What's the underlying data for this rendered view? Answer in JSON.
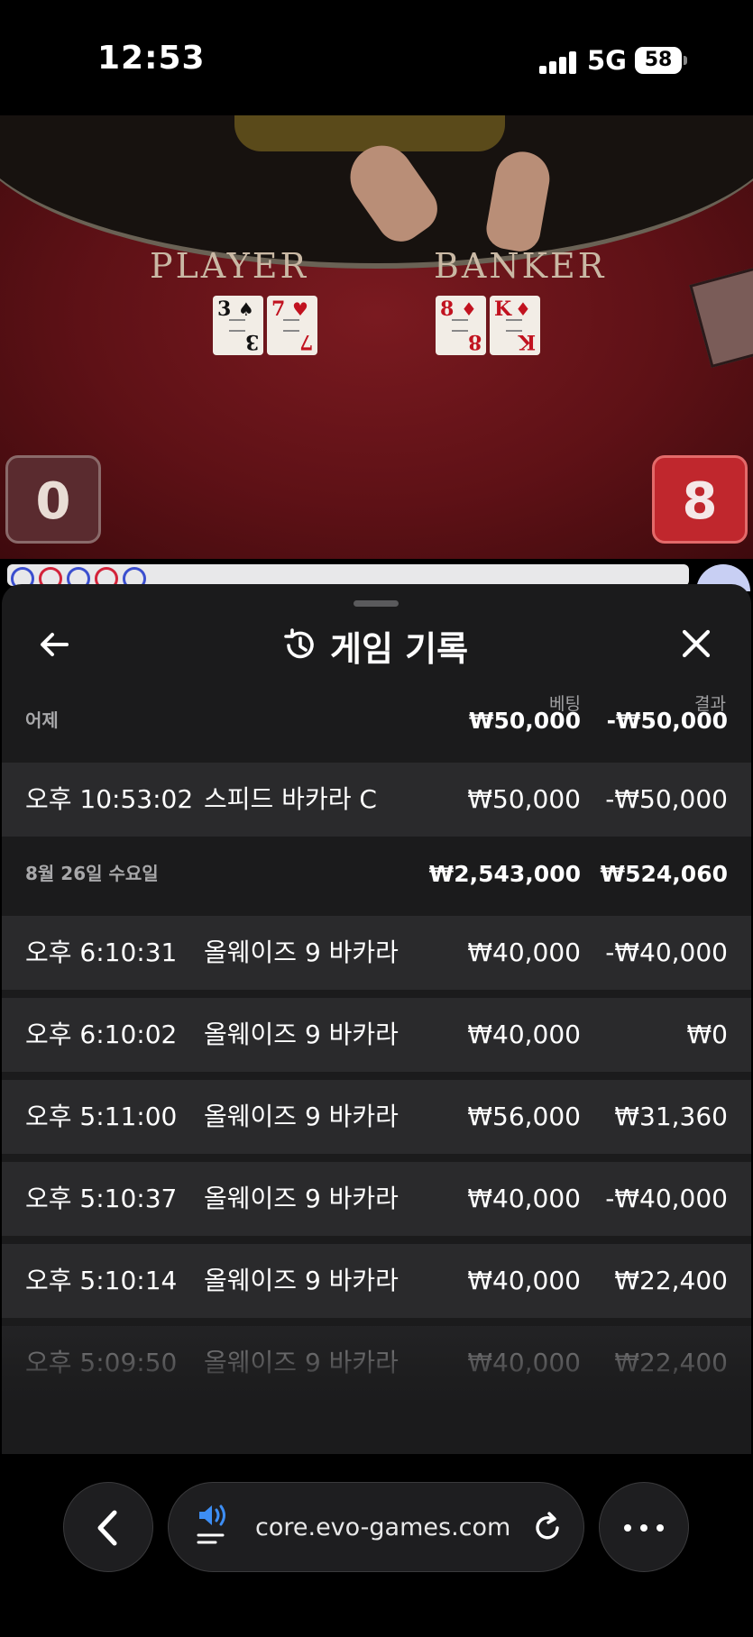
{
  "status_bar": {
    "time": "12:53",
    "network": "5G",
    "battery": "58"
  },
  "game": {
    "player_label": "PLAYER",
    "banker_label": "BANKER",
    "player_cards": [
      {
        "rank": "3",
        "suit": "♠",
        "color": "black"
      },
      {
        "rank": "7",
        "suit": "♥",
        "color": "red"
      }
    ],
    "banker_cards": [
      {
        "rank": "8",
        "suit": "♦",
        "color": "red"
      },
      {
        "rank": "K",
        "suit": "♦",
        "color": "red"
      }
    ],
    "player_score": "0",
    "banker_score": "8",
    "road_dots": [
      "#3b4fcf",
      "#d3233a",
      "#3b4fcf",
      "#d3233a",
      "#3b4fcf"
    ]
  },
  "history": {
    "title": "게임 기록",
    "col_bet": "베팅",
    "col_result": "결과",
    "groups": [
      {
        "label": "어제",
        "bet_total": "₩50,000",
        "result_total": "-₩50,000",
        "rows": [
          {
            "time": "오후 10:53:02",
            "game": "스피드 바카라 C",
            "bet": "₩50,000",
            "result": "-₩50,000"
          }
        ]
      },
      {
        "label": "8월 26일 수요일",
        "bet_total": "₩2,543,000",
        "result_total": "₩524,060",
        "rows": [
          {
            "time": "오후 6:10:31",
            "game": "올웨이즈 9 바카라",
            "bet": "₩40,000",
            "result": "-₩40,000"
          },
          {
            "time": "오후 6:10:02",
            "game": "올웨이즈 9 바카라",
            "bet": "₩40,000",
            "result": "₩0"
          },
          {
            "time": "오후 5:11:00",
            "game": "올웨이즈 9 바카라",
            "bet": "₩56,000",
            "result": "₩31,360"
          },
          {
            "time": "오후 5:10:37",
            "game": "올웨이즈 9 바카라",
            "bet": "₩40,000",
            "result": "-₩40,000"
          },
          {
            "time": "오후 5:10:14",
            "game": "올웨이즈 9 바카라",
            "bet": "₩40,000",
            "result": "₩22,400"
          },
          {
            "time": "오후 5:09:50",
            "game": "올웨이즈 9 바카라",
            "bet": "₩40,000",
            "result": "₩22,400"
          }
        ]
      }
    ]
  },
  "browser": {
    "url": "core.evo-games.com"
  },
  "icons": {
    "back": "arrow-left-icon",
    "close": "close-icon",
    "history": "history-icon",
    "nav_back": "chevron-left-icon",
    "speaker": "speaker-icon",
    "reload": "reload-icon",
    "more": "more-icon"
  }
}
